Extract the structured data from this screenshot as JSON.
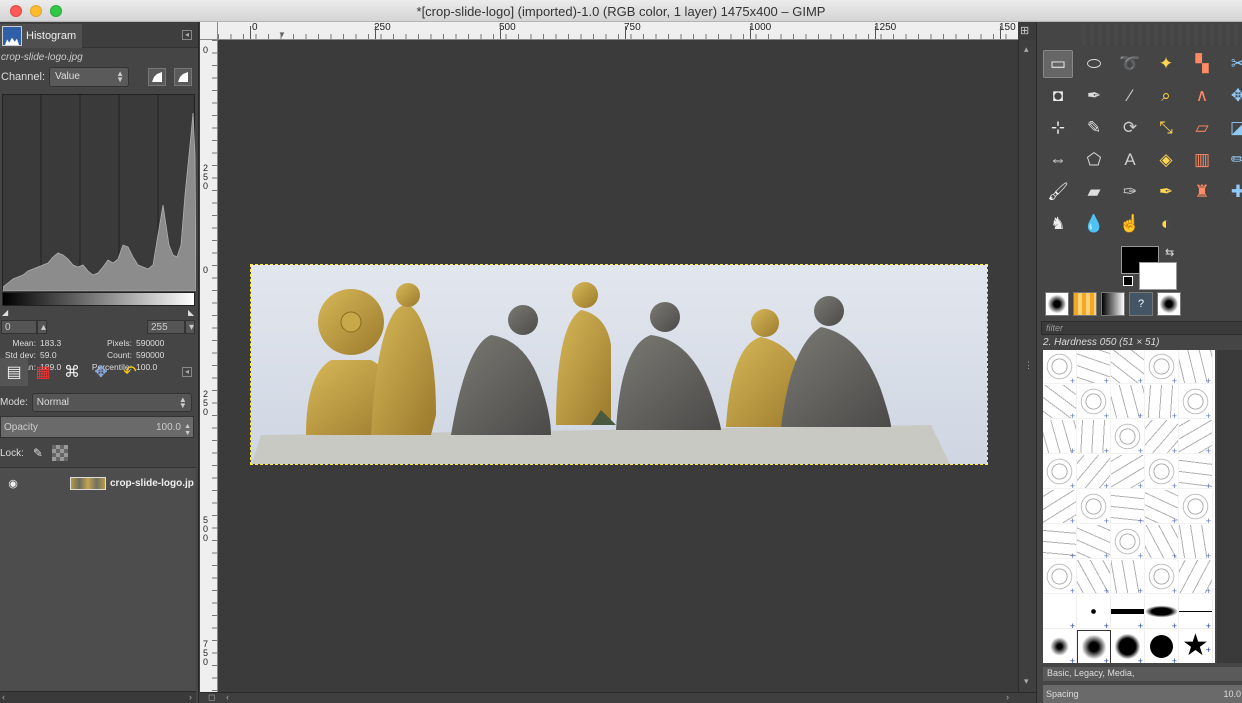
{
  "window": {
    "title": "*[crop-slide-logo] (imported)-1.0 (RGB color, 1 layer) 1475x400 – GIMP"
  },
  "histogram": {
    "tab_label": "Histogram",
    "file": "crop-slide-logo.jpg",
    "channel_label": "Channel:",
    "channel_value": "Value",
    "range_low": "0",
    "range_high": "255",
    "stats": {
      "mean_label": "Mean:",
      "mean": "183.3",
      "stddev_label": "Std dev:",
      "stddev": "59.0",
      "median_label": "Median:",
      "median": "189.0",
      "pixels_label": "Pixels:",
      "pixels": "590000",
      "count_label": "Count:",
      "count": "590000",
      "percentile_label": "Percentile:",
      "percentile": "100.0"
    }
  },
  "layers": {
    "mode_label": "Mode:",
    "mode_value": "Normal",
    "opacity_label": "Opacity",
    "opacity_value": "100.0",
    "lock_label": "Lock:",
    "layer_name": "crop-slide-logo.jp"
  },
  "rulers": {
    "top": [
      "0",
      "250",
      "500",
      "750",
      "1000",
      "1250",
      "150"
    ],
    "left": [
      "0",
      "250",
      "0",
      "250",
      "500",
      "750"
    ]
  },
  "brushes": {
    "filter_placeholder": "filter",
    "selected_name": "2. Hardness 050 (51 × 51)",
    "tags": "Basic, Legacy, Media,",
    "spacing_label": "Spacing",
    "spacing_value": "10.0"
  },
  "colors": {
    "foreground": "#000000",
    "background": "#ffffff",
    "selection": "#ffeb3b"
  },
  "icons": {
    "toolbox": [
      "rect-select-icon",
      "ellipse-select-icon",
      "lasso-icon",
      "fuzzy-select-icon",
      "select-by-color-icon",
      "scissors-icon",
      "foreground-select-icon",
      "paths-icon",
      "color-picker-icon",
      "zoom-icon",
      "measure-icon",
      "move-icon",
      "align-icon",
      "crop-icon",
      "rotate-icon",
      "scale-icon",
      "shear-icon",
      "perspective-icon",
      "flip-icon",
      "cage-icon",
      "text-icon",
      "bucket-fill-icon",
      "blend-icon",
      "pencil-icon",
      "paintbrush-icon",
      "eraser-icon",
      "airbrush-icon",
      "ink-icon",
      "clone-icon",
      "heal-icon",
      "perspective-clone-icon",
      "blur-icon",
      "smudge-icon",
      "dodge-icon"
    ]
  }
}
